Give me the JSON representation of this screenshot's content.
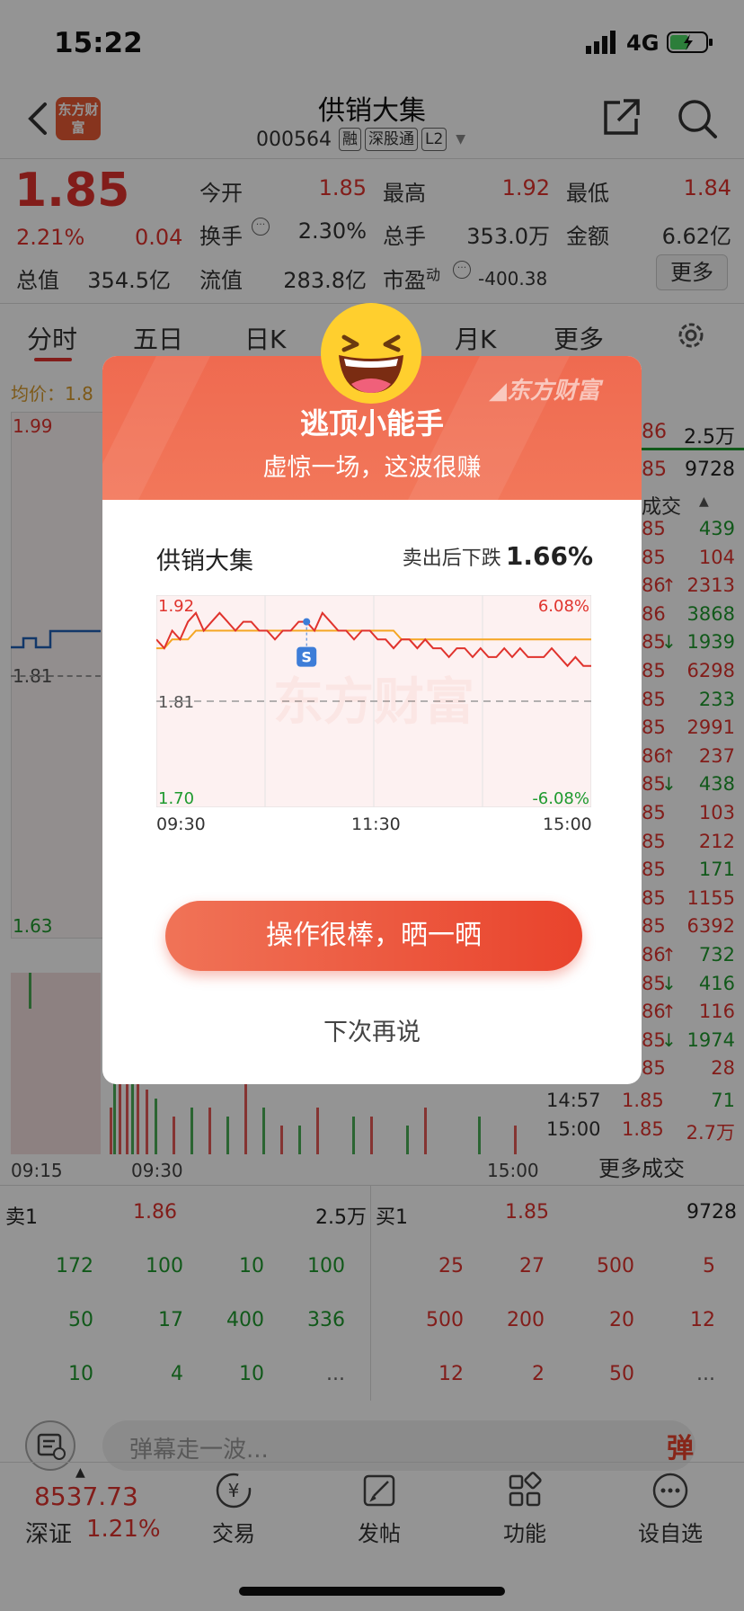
{
  "status_bar": {
    "time": "15:22",
    "network": "4G"
  },
  "header": {
    "title": "供销大集",
    "code": "000564",
    "tags": [
      "融",
      "深股通",
      "L2"
    ],
    "logo_text": "东方财富"
  },
  "quote": {
    "price": "1.85",
    "change_pct": "2.21%",
    "change": "0.04",
    "fields": [
      {
        "label": "今开",
        "value": "1.85"
      },
      {
        "label": "最高",
        "value": "1.92"
      },
      {
        "label": "最低",
        "value": "1.84"
      },
      {
        "label": "换手",
        "value": "2.30%"
      },
      {
        "label": "总手",
        "value": "353.0万"
      },
      {
        "label": "金额",
        "value": "6.62亿"
      },
      {
        "label": "总值",
        "value": "354.5亿"
      },
      {
        "label": "流值",
        "value": "283.8亿"
      },
      {
        "label": "市盈",
        "label_sup": "动",
        "value": "-400.38"
      }
    ],
    "more_button": "更多"
  },
  "tabs": [
    "分时",
    "五日",
    "日K",
    "月K",
    "更多"
  ],
  "chart_bg": {
    "avg_label": "均价：1.8",
    "y_top": "1.99",
    "y_mid": "1.81",
    "y_bottom": "1.63",
    "x_labels": [
      "09:15",
      "09:30",
      "15:00"
    ]
  },
  "trades": {
    "top_rows": [
      {
        "price": "86",
        "vol": "2.5万"
      },
      {
        "price": "85",
        "vol": "9728"
      }
    ],
    "header": "成交",
    "rows": [
      {
        "p": "85",
        "v": "439",
        "d": ""
      },
      {
        "p": "85",
        "v": "104",
        "d": ""
      },
      {
        "p": "86",
        "v": "2313",
        "d": "↑"
      },
      {
        "p": "86",
        "v": "3868",
        "d": ""
      },
      {
        "p": "85",
        "v": "1939",
        "d": "↓"
      },
      {
        "p": "85",
        "v": "6298",
        "d": ""
      },
      {
        "p": "85",
        "v": "233",
        "d": ""
      },
      {
        "p": "85",
        "v": "2991",
        "d": ""
      },
      {
        "p": "86",
        "v": "237",
        "d": "↑"
      },
      {
        "p": "85",
        "v": "438",
        "d": "↓"
      },
      {
        "p": "85",
        "v": "103",
        "d": ""
      },
      {
        "p": "85",
        "v": "212",
        "d": ""
      },
      {
        "p": "85",
        "v": "171",
        "d": ""
      },
      {
        "p": "85",
        "v": "1155",
        "d": ""
      },
      {
        "p": "85",
        "v": "6392",
        "d": ""
      },
      {
        "p": "86",
        "v": "732",
        "d": "↑"
      },
      {
        "p": "85",
        "v": "416",
        "d": "↓"
      },
      {
        "p": "86",
        "v": "116",
        "d": "↑"
      },
      {
        "p": "85",
        "v": "1974",
        "d": "↓"
      },
      {
        "p": "85",
        "v": "28",
        "d": ""
      }
    ],
    "tail_rows": [
      {
        "t": "14:57",
        "p": "1.85",
        "v": "71"
      },
      {
        "t": "15:00",
        "p": "1.85",
        "v": "2.7万"
      }
    ],
    "more": "更多成交"
  },
  "order_book": {
    "sell_label": "卖1",
    "sell_price": "1.86",
    "sell_vol": "2.5万",
    "buy_label": "买1",
    "buy_price": "1.85",
    "buy_vol": "9728",
    "sell_rows": [
      [
        "172",
        "100",
        "10",
        "100"
      ],
      [
        "50",
        "17",
        "400",
        "336"
      ],
      [
        "10",
        "4",
        "10",
        "..."
      ]
    ],
    "buy_rows": [
      [
        "25",
        "27",
        "500",
        "5"
      ],
      [
        "500",
        "200",
        "20",
        "12"
      ],
      [
        "12",
        "2",
        "50",
        "..."
      ]
    ]
  },
  "danmaku": {
    "placeholder": "弹幕走一波...",
    "badge": "弹"
  },
  "bottom_nav": {
    "index_value": "8537.73",
    "index_name": "深证",
    "index_change": "1.21%",
    "items": [
      "交易",
      "发帖",
      "功能",
      "设自选"
    ]
  },
  "modal": {
    "brand": "东方财富",
    "title": "逃顶小能手",
    "subtitle": "虚惊一场，这波很赚",
    "stock_name": "供销大集",
    "drop_label": "卖出后下跌",
    "drop_value": "1.66%",
    "watermark": "东方财富",
    "sell_marker": "S",
    "primary_button": "操作很棒，晒一晒",
    "secondary_button": "下次再说",
    "colors": {
      "price_line": "#e0332d",
      "avg_line": "#f5a623",
      "accent": "#e9432c"
    }
  },
  "chart_data": {
    "type": "line",
    "y_left_labels": [
      "1.92",
      "1.81",
      "1.70"
    ],
    "y_right_labels": [
      "6.08%",
      "-6.08%"
    ],
    "x_labels": [
      "09:30",
      "11:30",
      "15:00"
    ],
    "ylim": [
      1.7,
      1.92
    ],
    "baseline": 1.81,
    "series": [
      {
        "values": [
          1.88,
          1.87,
          1.89,
          1.88,
          1.9,
          1.91,
          1.89,
          1.9,
          1.91,
          1.9,
          1.89,
          1.9,
          1.9,
          1.89,
          1.89,
          1.88,
          1.89,
          1.89,
          1.9,
          1.9,
          1.89,
          1.91,
          1.9,
          1.89,
          1.89,
          1.88,
          1.89,
          1.89,
          1.88,
          1.88,
          1.87,
          1.88,
          1.88,
          1.87,
          1.88,
          1.87,
          1.87,
          1.86,
          1.87,
          1.87,
          1.86,
          1.87,
          1.86,
          1.86,
          1.87,
          1.86,
          1.87,
          1.86,
          1.86,
          1.86,
          1.87,
          1.86,
          1.85,
          1.86,
          1.85,
          1.85
        ]
      },
      {
        "values": [
          1.87,
          1.87,
          1.88,
          1.88,
          1.88,
          1.89,
          1.89,
          1.89,
          1.89,
          1.89,
          1.89,
          1.89,
          1.89,
          1.89,
          1.89,
          1.89,
          1.89,
          1.89,
          1.89,
          1.89,
          1.89,
          1.89,
          1.89,
          1.89,
          1.89,
          1.89,
          1.89,
          1.89,
          1.89,
          1.89,
          1.89,
          1.88,
          1.88,
          1.88,
          1.88,
          1.88,
          1.88,
          1.88,
          1.88,
          1.88,
          1.88,
          1.88,
          1.88,
          1.88,
          1.88,
          1.88,
          1.88,
          1.88,
          1.88,
          1.88,
          1.88,
          1.88,
          1.88,
          1.88,
          1.88,
          1.88
        ]
      }
    ],
    "sell_point_index": 19
  }
}
